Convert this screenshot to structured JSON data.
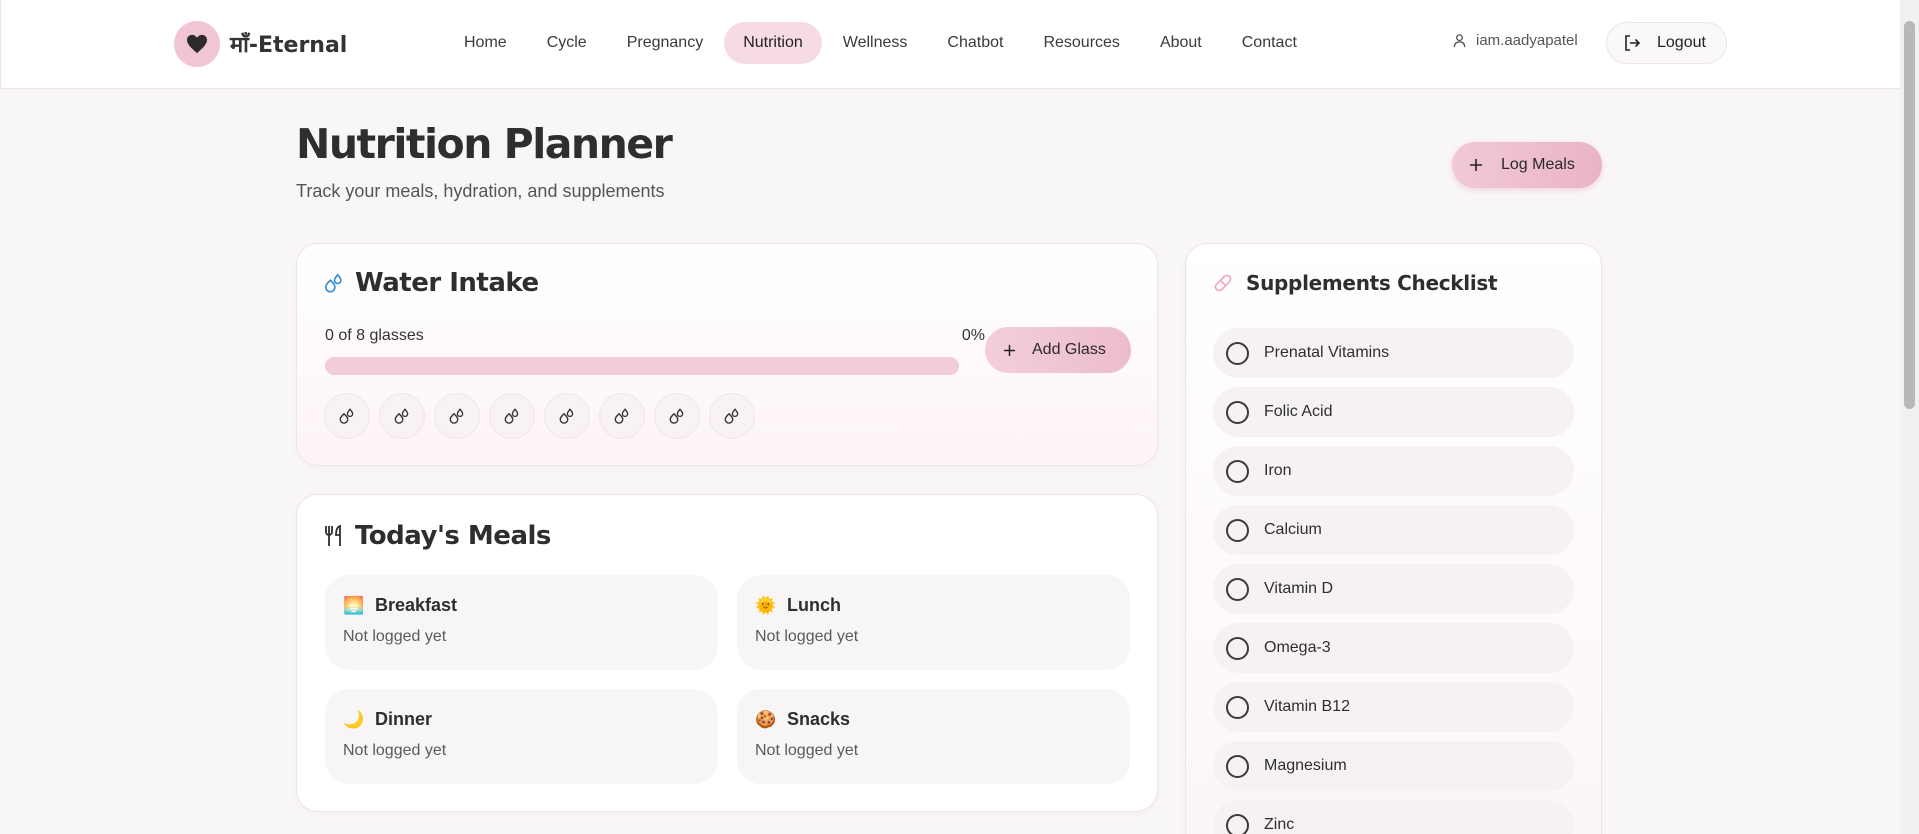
{
  "brand": {
    "name": "माँ-Eternal",
    "icon": "heart-icon"
  },
  "nav": {
    "items": [
      {
        "label": "Home"
      },
      {
        "label": "Cycle"
      },
      {
        "label": "Pregnancy"
      },
      {
        "label": "Nutrition",
        "active": true
      },
      {
        "label": "Wellness"
      },
      {
        "label": "Chatbot"
      },
      {
        "label": "Resources"
      },
      {
        "label": "About"
      },
      {
        "label": "Contact"
      }
    ],
    "username": "iam.aadyapatel",
    "logout_label": "Logout"
  },
  "page": {
    "title": "Nutrition Planner",
    "subtitle": "Track your meals, hydration, and supplements",
    "log_meals_label": "Log Meals"
  },
  "water": {
    "title": "Water Intake",
    "glasses_text": "0 of 8 glasses",
    "percent_text": "0%",
    "progress": 0,
    "add_glass_label": "Add Glass",
    "glasses_total": 8,
    "glasses_filled": 0
  },
  "meals": {
    "title": "Today's Meals",
    "items": [
      {
        "name": "Breakfast",
        "emoji": "🌅",
        "status": "Not logged yet"
      },
      {
        "name": "Lunch",
        "emoji": "🌞",
        "status": "Not logged yet"
      },
      {
        "name": "Dinner",
        "emoji": "🌙",
        "status": "Not logged yet"
      },
      {
        "name": "Snacks",
        "emoji": "🍪",
        "status": "Not logged yet"
      }
    ]
  },
  "supplements": {
    "title": "Supplements Checklist",
    "items": [
      {
        "label": "Prenatal Vitamins",
        "checked": false
      },
      {
        "label": "Folic Acid",
        "checked": false
      },
      {
        "label": "Iron",
        "checked": false
      },
      {
        "label": "Calcium",
        "checked": false
      },
      {
        "label": "Vitamin D",
        "checked": false
      },
      {
        "label": "Omega-3",
        "checked": false
      },
      {
        "label": "Vitamin B12",
        "checked": false
      },
      {
        "label": "Magnesium",
        "checked": false
      },
      {
        "label": "Zinc",
        "checked": false
      }
    ]
  },
  "colors": {
    "accent_pink": "#f7dbe4",
    "button_pink": "#eab4c6",
    "water_blue": "#3a8fd8",
    "pill_pink": "#f0a6bd"
  }
}
